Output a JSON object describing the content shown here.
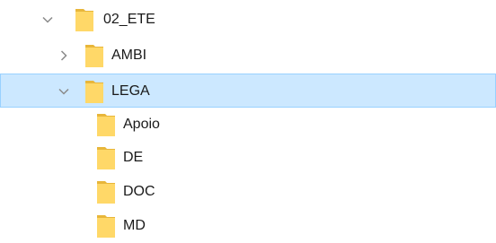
{
  "tree": {
    "nodes": [
      {
        "label": "02_ETE",
        "expander": "chevron-down",
        "selected": false
      },
      {
        "label": "AMBI",
        "expander": "chevron-right",
        "selected": false
      },
      {
        "label": "LEGA",
        "expander": "chevron-down",
        "selected": true
      },
      {
        "label": "Apoio",
        "expander": "none",
        "selected": false
      },
      {
        "label": "DE",
        "expander": "none",
        "selected": false
      },
      {
        "label": "DOC",
        "expander": "none",
        "selected": false
      },
      {
        "label": "MD",
        "expander": "none",
        "selected": false
      }
    ],
    "icon": "folder-icon"
  },
  "colors": {
    "selection_fill": "#cce8ff",
    "selection_border": "#99d1ff",
    "folder_body": "#ffd868",
    "folder_back": "#e8b63a",
    "chevron": "#8a8a8a",
    "text": "#1a1a1a"
  }
}
